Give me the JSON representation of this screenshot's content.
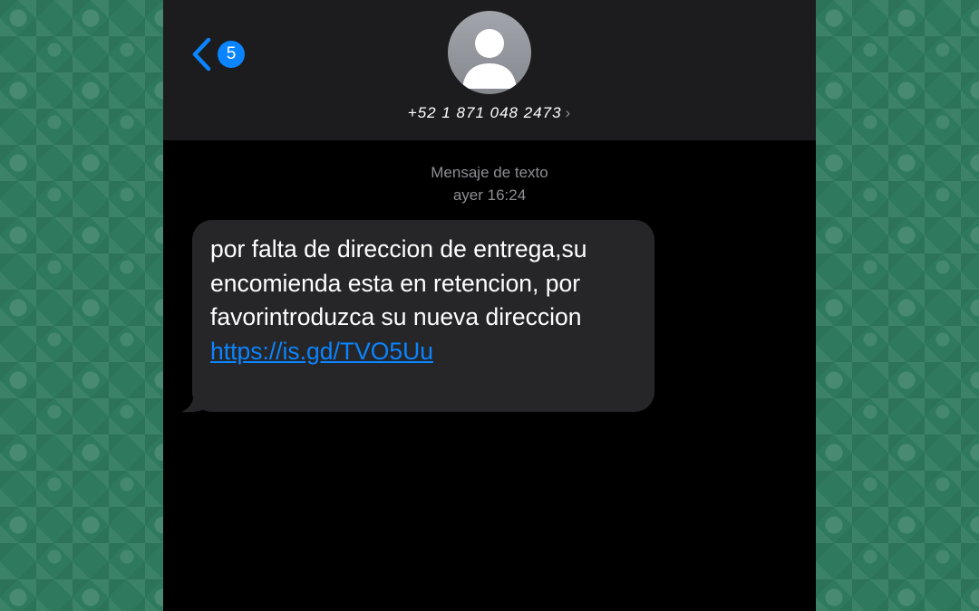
{
  "header": {
    "back_badge_count": "5",
    "contact_name": "+52 1 871 048 2473",
    "contact_chevron": "›"
  },
  "conversation": {
    "message_type": "Mensaje de texto",
    "timestamp": "ayer 16:24",
    "message": {
      "text": "por falta de direccion de entrega,su encomienda esta en retencion, por favorintroduzca su nueva direccion ",
      "link_text": "https://is.gd/TVO5Uu"
    }
  },
  "colors": {
    "accent": "#0a84ff",
    "bubble": "#262628",
    "header": "#1c1c1e",
    "wallpaper": "#2f7a5f"
  },
  "icons": [
    "chevron-left-icon",
    "person-avatar-icon"
  ]
}
